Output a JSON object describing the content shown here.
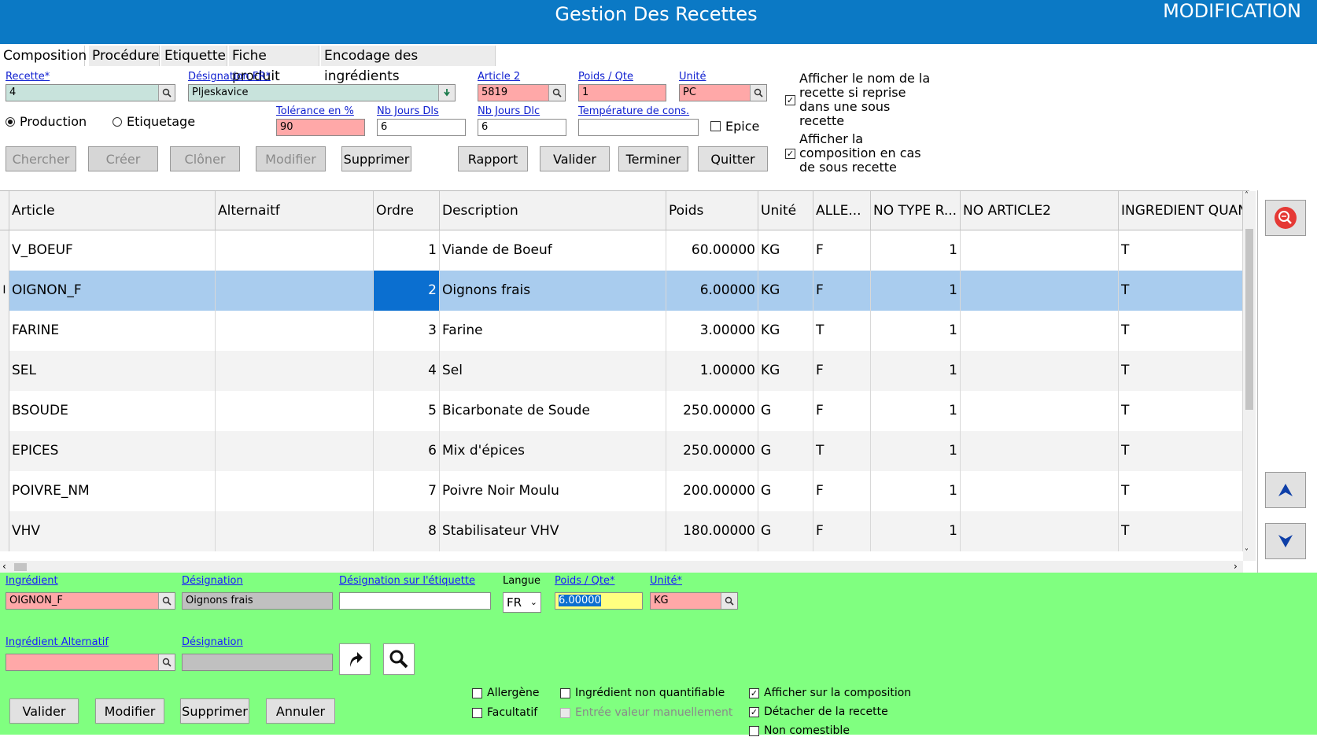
{
  "header": {
    "title": "Gestion Des Recettes",
    "mode": "MODIFICATION"
  },
  "tabs": [
    "Composition",
    "Procédure",
    "Etiquette",
    "Fiche produit",
    "Encodage des ingrédients"
  ],
  "form": {
    "recette_label": "Recette*",
    "recette_value": "4",
    "designation_label": "Désignation FR*",
    "designation_value": "Pljeskavice",
    "article2_label": "Article 2",
    "article2_value": "5819",
    "poids_label": "Poids / Qte",
    "poids_value": "1",
    "unite_label": "Unité",
    "unite_value": "PC",
    "tolerance_label": "Tolérance en %",
    "tolerance_value": "90",
    "nbjdls_label": "Nb Jours Dls",
    "nbjdls_value": "6",
    "nbjdlc_label": "Nb Jours Dlc",
    "nbjdlc_value": "6",
    "temp_label": "Température de cons.",
    "temp_value": "",
    "radio_production": "Production",
    "radio_etiquetage": "Etiquetage",
    "epice_label": "Epice",
    "check1_label": "Afficher le nom de la recette si reprise dans une sous recette",
    "check2_label": "Afficher la composition en cas de sous recette"
  },
  "buttons": {
    "chercher": "Chercher",
    "creer": "Créer",
    "cloner": "Clôner",
    "modifier": "Modifier",
    "supprimer": "Supprimer",
    "rapport": "Rapport",
    "valider": "Valider",
    "terminer": "Terminer",
    "quitter": "Quitter"
  },
  "grid": {
    "headers": [
      "Article",
      "Alternaitf",
      "Ordre",
      "Description",
      "Poids",
      "Unité",
      "ALLE...",
      "NO TYPE R...",
      "NO ARTICLE2",
      "INGREDIENT QUAN"
    ],
    "rows": [
      {
        "article": "V_BOEUF",
        "alt": "",
        "ordre": "1",
        "desc": "Viande de Boeuf",
        "poids": "60.00000",
        "unite": "KG",
        "alle": "F",
        "notype": "1",
        "noart": "",
        "ingq": "T"
      },
      {
        "article": "OIGNON_F",
        "alt": "",
        "ordre": "2",
        "desc": "Oignons frais",
        "poids": "6.00000",
        "unite": "KG",
        "alle": "F",
        "notype": "1",
        "noart": "",
        "ingq": "T"
      },
      {
        "article": "FARINE",
        "alt": "",
        "ordre": "3",
        "desc": "Farine",
        "poids": "3.00000",
        "unite": "KG",
        "alle": "T",
        "notype": "1",
        "noart": "",
        "ingq": "T"
      },
      {
        "article": "SEL",
        "alt": "",
        "ordre": "4",
        "desc": "Sel",
        "poids": "1.00000",
        "unite": "KG",
        "alle": "F",
        "notype": "1",
        "noart": "",
        "ingq": "T"
      },
      {
        "article": "BSOUDE",
        "alt": "",
        "ordre": "5",
        "desc": "Bicarbonate de Soude",
        "poids": "250.00000",
        "unite": "G",
        "alle": "F",
        "notype": "1",
        "noart": "",
        "ingq": "T"
      },
      {
        "article": "EPICES",
        "alt": "",
        "ordre": "6",
        "desc": "Mix d'épices",
        "poids": "250.00000",
        "unite": "G",
        "alle": "T",
        "notype": "1",
        "noart": "",
        "ingq": "T"
      },
      {
        "article": "POIVRE_NM",
        "alt": "",
        "ordre": "7",
        "desc": "Poivre Noir Moulu",
        "poids": "200.00000",
        "unite": "G",
        "alle": "F",
        "notype": "1",
        "noart": "",
        "ingq": "T"
      },
      {
        "article": "VHV",
        "alt": "",
        "ordre": "8",
        "desc": "Stabilisateur VHV",
        "poids": "180.00000",
        "unite": "G",
        "alle": "F",
        "notype": "1",
        "noart": "",
        "ingq": "T"
      }
    ]
  },
  "detail": {
    "ingredient_label": "Ingrédient",
    "ingredient_value": "OIGNON_F",
    "designation_label": "Désignation",
    "designation_value": "Oignons frais",
    "desig_etiq_label": "Désignation sur l'étiquette",
    "desig_etiq_value": "",
    "langue_label": "Langue",
    "langue_value": "FR",
    "poids_label": "Poids / Qte*",
    "poids_value": "6.00000",
    "unite_label": "Unité*",
    "unite_value": "KG",
    "alt_label": "Ingrédient Alternatif",
    "alt_value": "",
    "alt_desig_label": "Désignation",
    "alt_desig_value": "",
    "cb_allergene": "Allergène",
    "cb_facultatif": "Facultatif",
    "cb_nonquant": "Ingrédient non quantifiable",
    "cb_entree": "Entrée valeur manuellement",
    "cb_afficher": "Afficher sur la composition",
    "cb_detacher": "Détacher de la recette",
    "cb_noncomestible": "Non comestible",
    "btn_valider": "Valider",
    "btn_modifier": "Modifier",
    "btn_supprimer": "Supprimer",
    "btn_annuler": "Annuler"
  }
}
